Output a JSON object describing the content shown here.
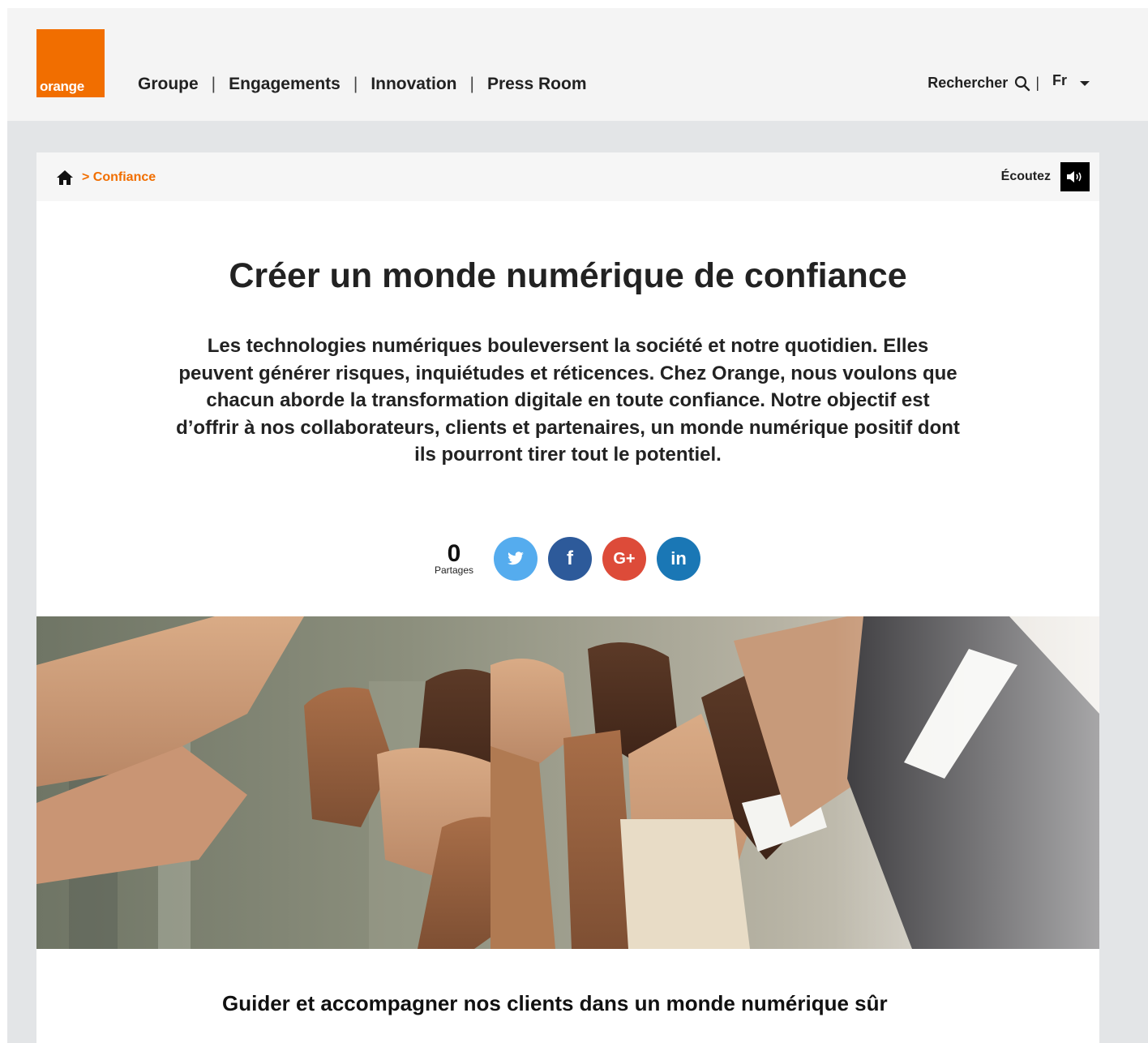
{
  "header": {
    "logo_text": "orange",
    "nav": [
      {
        "label": "Groupe"
      },
      {
        "label": "Engagements"
      },
      {
        "label": "Innovation"
      },
      {
        "label": "Press Room"
      }
    ],
    "search_label": "Rechercher",
    "language": "Fr"
  },
  "breadcrumb": {
    "current": "> Confiance"
  },
  "listen": {
    "label": "Écoutez"
  },
  "article": {
    "title": "Créer un monde numérique de confiance",
    "intro": "Les technologies numériques bouleversent la société et notre quotidien. Elles peuvent générer risques, inquiétudes et réticences. Chez Orange, nous voulons que chacun aborde la transformation digitale en toute confiance. Notre objectif est d’offrir à nos collaborateurs, clients et partenaires, un monde numérique positif dont ils pourront tirer tout le potentiel.",
    "section_heading": "Guider et accompagner nos clients dans un monde numérique sûr"
  },
  "share": {
    "count": "0",
    "count_label": "Partages",
    "networks": [
      {
        "name": "twitter",
        "glyph": "",
        "icon": "twitter-icon",
        "color": "#55acee"
      },
      {
        "name": "facebook",
        "glyph": "f",
        "icon": "facebook-icon",
        "color": "#2d5a9a"
      },
      {
        "name": "google-plus",
        "glyph": "G+",
        "icon": "google-plus-icon",
        "color": "#dd4b39"
      },
      {
        "name": "linkedin",
        "glyph": "in",
        "icon": "linkedin-icon",
        "color": "#1a77b5"
      }
    ]
  },
  "colors": {
    "brand": "#f16e00",
    "page_bg": "#e3e5e7"
  }
}
